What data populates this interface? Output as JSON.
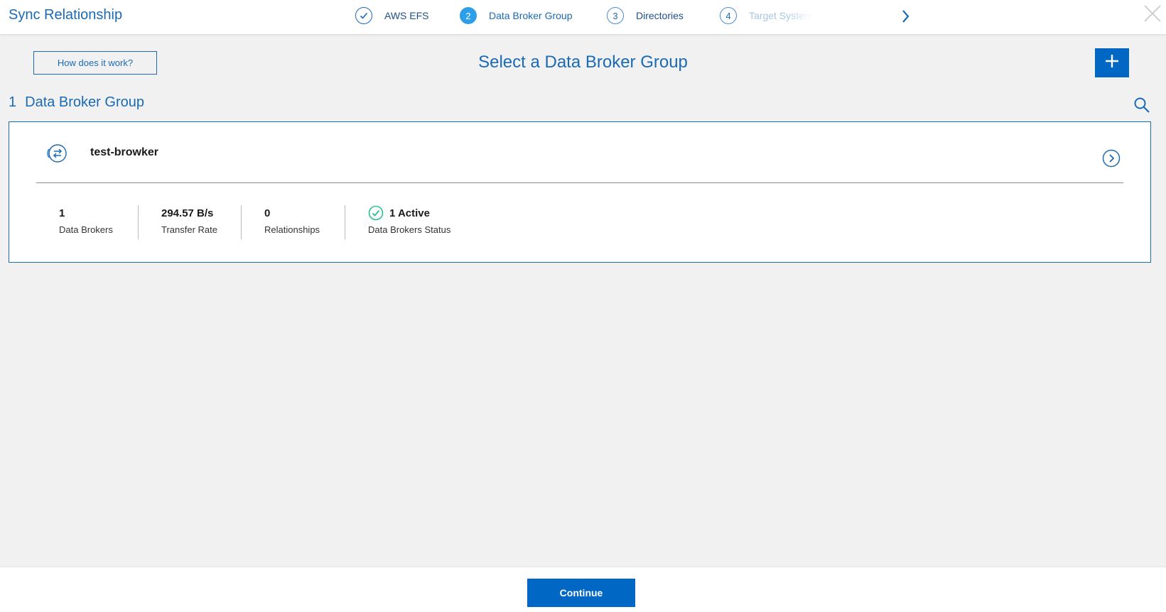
{
  "header": {
    "title": "Sync Relationship",
    "steps": [
      {
        "number": "",
        "label": "AWS EFS",
        "state": "complete"
      },
      {
        "number": "2",
        "label": "Data Broker Group",
        "state": "current"
      },
      {
        "number": "3",
        "label": "Directories",
        "state": "upcoming"
      },
      {
        "number": "4",
        "label": "Target System",
        "state": "upcoming-truncated"
      }
    ],
    "icons": {
      "next": "chevron-right-icon",
      "close": "close-icon"
    }
  },
  "toolbar": {
    "how_label": "How does it work?",
    "page_title": "Select a Data Broker Group",
    "add_icon": "plus-icon"
  },
  "list": {
    "count": "1",
    "count_label": "Data Broker Group",
    "search_icon": "search-icon"
  },
  "card": {
    "name": "test-browker",
    "icon": "data-broker-group-icon",
    "stats": [
      {
        "value": "1",
        "caption": "Data Brokers"
      },
      {
        "value": "294.57 B/s",
        "caption": "Transfer Rate"
      },
      {
        "value": "0",
        "caption": "Relationships"
      },
      {
        "value": "1 Active",
        "caption": "Data Brokers Status",
        "status_icon": "check-circle-icon"
      }
    ]
  },
  "footer": {
    "continue_label": "Continue"
  },
  "colors": {
    "accent": "#1b6ab5",
    "primary_button": "#0067c5",
    "active_step": "#2d9fe8",
    "status_ok": "#2bbf8e"
  }
}
